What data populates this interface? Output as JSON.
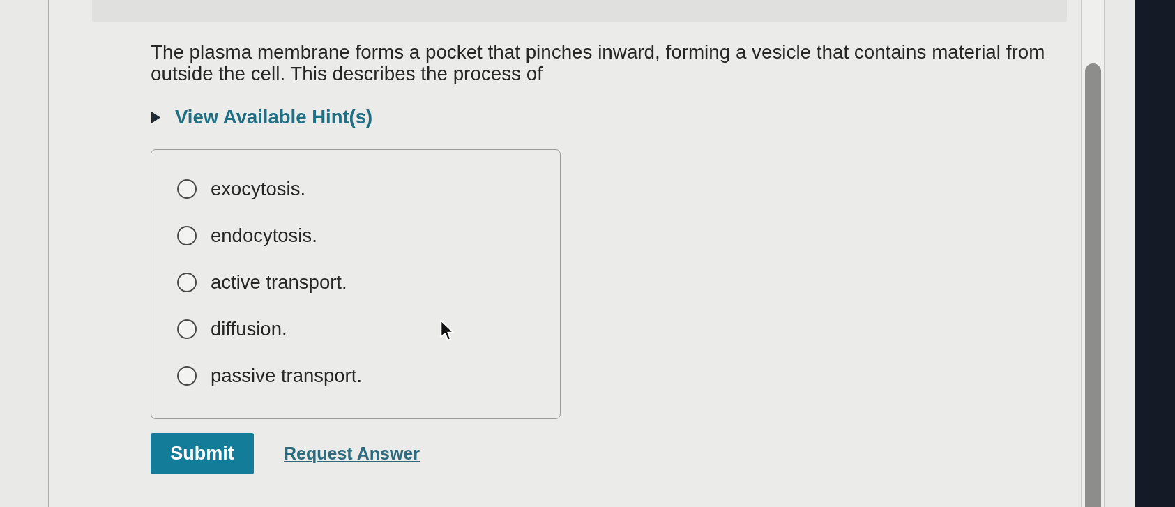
{
  "question": {
    "text": "The plasma membrane forms a pocket that pinches inward, forming a vesicle that contains material from outside the cell. This describes the process of"
  },
  "hint_toggle": {
    "label": "View Available Hint(s)",
    "expanded": false
  },
  "options": [
    {
      "label": "exocytosis.",
      "selected": false
    },
    {
      "label": "endocytosis.",
      "selected": false
    },
    {
      "label": "active transport.",
      "selected": false
    },
    {
      "label": "diffusion.",
      "selected": false
    },
    {
      "label": "passive transport.",
      "selected": false
    }
  ],
  "actions": [
    {
      "kind": "primary",
      "label": "Submit"
    },
    {
      "kind": "link",
      "label": "Request Answer"
    }
  ]
}
